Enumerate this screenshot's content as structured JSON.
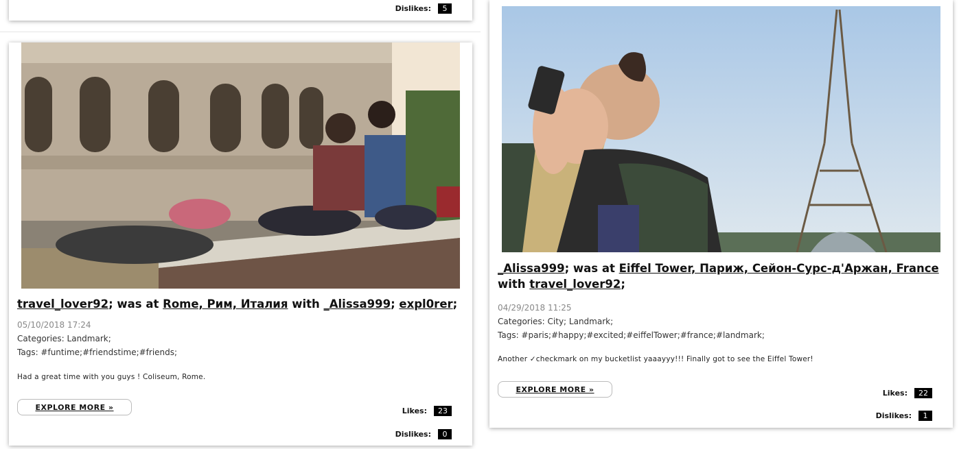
{
  "top_card": {
    "dislikes_label": "Dislikes:",
    "dislikes": "5"
  },
  "posts": [
    {
      "user": "travel_lover92",
      "was_at": "; was at ",
      "place": "Rome, Рим, Италия",
      "with": " with ",
      "friends": [
        "_Alissa999",
        "expl0rer"
      ],
      "date": "05/10/2018 17:24",
      "categories": "Categories: Landmark;",
      "tags": "Tags: #funtime;#friendstime;#friends;",
      "description": "Had a great time with you guys ! Coliseum, Rome.",
      "explore": "EXPLORE MORE »",
      "likes_label": "Likes:",
      "likes": "23",
      "dislikes_label": "Dislikes:",
      "dislikes": "0"
    },
    {
      "user": "_Alissa999",
      "was_at": "; was at ",
      "place": "Eiffel Tower, Париж, Сейон-Сурс-д'Аржан, France",
      "with": " with ",
      "friends": [
        "travel_lover92"
      ],
      "date": "04/29/2018 11:25",
      "categories": "Categories: City; Landmark;",
      "tags": "Tags: #paris;#happy;#excited;#eiffelTower;#france;#landmark;",
      "description": "Another ✓checkmark on my bucketlist yaaayyy!!! Finally got to see the Eiffel Tower!",
      "explore": "EXPLORE MORE »",
      "likes_label": "Likes:",
      "likes": "22",
      "dislikes_label": "Dislikes:",
      "dislikes": "1"
    }
  ]
}
